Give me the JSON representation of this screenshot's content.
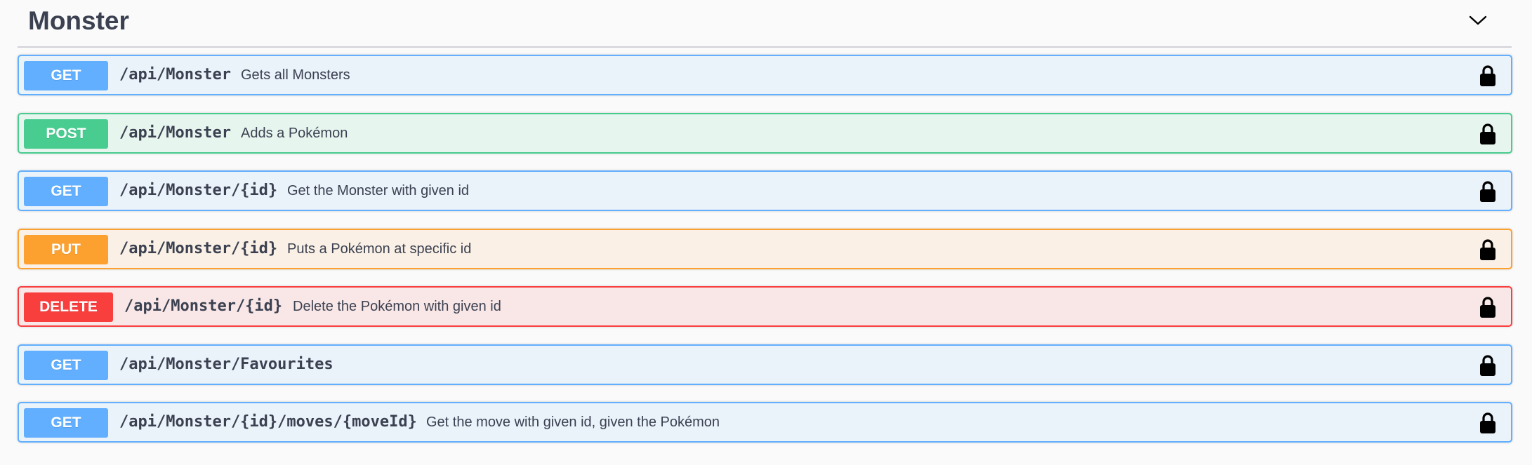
{
  "tag": {
    "name": "Monster",
    "toggle_icon": "chevron-down-icon"
  },
  "operations": [
    {
      "method": "GET",
      "path": "/api/Monster",
      "summary": "Gets all Monsters",
      "lock_icon": "lock-icon"
    },
    {
      "method": "POST",
      "path": "/api/Monster",
      "summary": "Adds a Pokémon",
      "lock_icon": "lock-icon"
    },
    {
      "method": "GET",
      "path": "/api/Monster/{id}",
      "summary": "Get the Monster with given id",
      "lock_icon": "lock-icon"
    },
    {
      "method": "PUT",
      "path": "/api/Monster/{id}",
      "summary": "Puts a Pokémon at specific id",
      "lock_icon": "lock-icon"
    },
    {
      "method": "DELETE",
      "path": "/api/Monster/{id}",
      "summary": "Delete the Pokémon with given id",
      "lock_icon": "lock-icon"
    },
    {
      "method": "GET",
      "path": "/api/Monster/Favourites",
      "summary": "",
      "lock_icon": "lock-icon"
    },
    {
      "method": "GET",
      "path": "/api/Monster/{id}/moves/{moveId}",
      "summary": "Get the move with given id, given the Pokémon",
      "lock_icon": "lock-icon"
    }
  ],
  "colors": {
    "get": "#61affe",
    "post": "#49cc90",
    "put": "#fca130",
    "delete": "#f93e3e",
    "text": "#3b4151"
  }
}
